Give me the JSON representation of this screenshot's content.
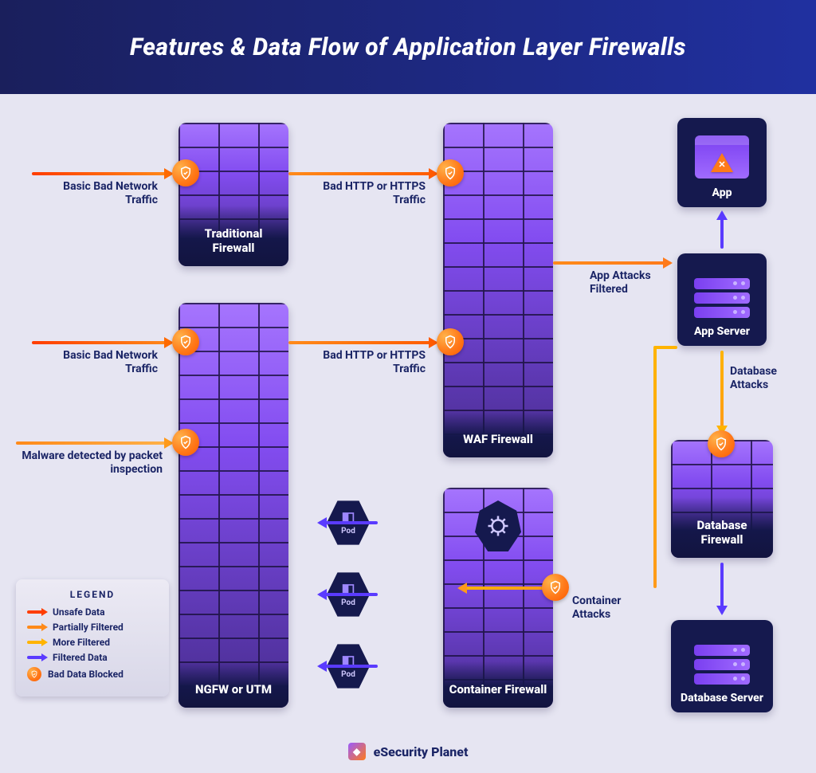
{
  "title": "Features & Data Flow of Application Layer Firewalls",
  "brand": "eSecurity Planet",
  "walls": {
    "traditional": "Traditional Firewall",
    "ngfw": "NGFW or UTM",
    "waf": "WAF Firewall",
    "container": "Container Firewall",
    "database": "Database Firewall"
  },
  "cards": {
    "app": "App",
    "app_server": "App Server",
    "db_server": "Database Server"
  },
  "pods": {
    "label": "Pod"
  },
  "notes": {
    "basic_bad_1": "Basic Bad Network Traffic",
    "basic_bad_2": "Basic Bad Network Traffic",
    "malware": "Malware detected by packet inspection",
    "bad_http_1": "Bad HTTP or HTTPS Traffic",
    "bad_http_2": "Bad HTTP or HTTPS Traffic",
    "app_attacks": "App Attacks Filtered",
    "db_attacks": "Database Attacks",
    "container_attacks": "Container Attacks"
  },
  "legend": {
    "title": "LEGEND",
    "unsafe": "Unsafe Data",
    "partial": "Partially Filtered",
    "more": "More Filtered",
    "filtered": "Filtered Data",
    "blocked": "Bad Data Blocked"
  },
  "colors": {
    "unsafe": "#ff3d00",
    "partial": "#ff8a1a",
    "more": "#ffb400",
    "filtered": "#5a3bff"
  }
}
